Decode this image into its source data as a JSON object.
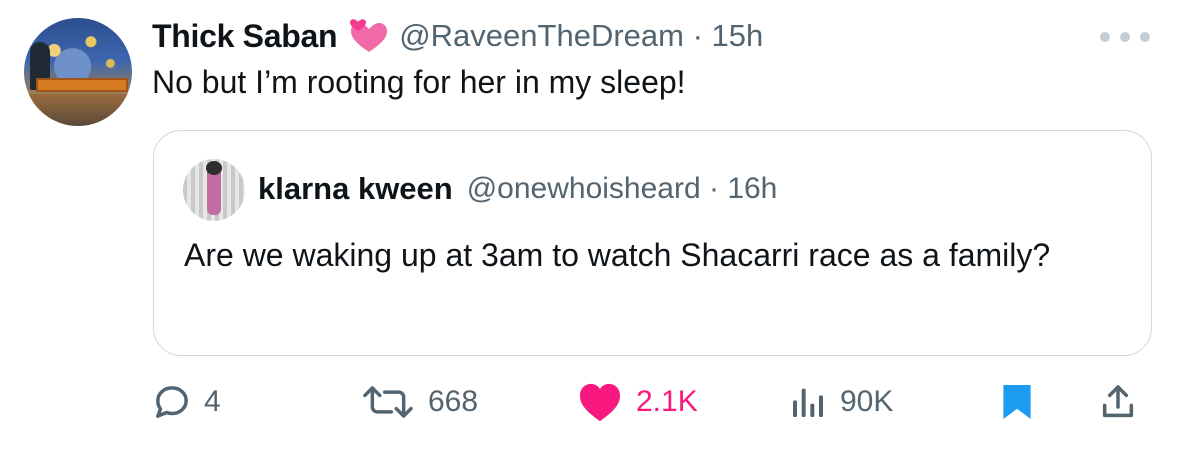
{
  "tweet": {
    "author_name": "Thick Saban",
    "author_emoji": "two-hearts-emoji",
    "handle_time": "@RaveenTheDream · 15h",
    "text": "No but I’m rooting for her in my sleep!"
  },
  "quoted_tweet": {
    "author_name": "klarna kween",
    "handle_time": "@onewhoisheard · 16h",
    "text": "Are we waking up at 3am to watch Shacarri race as a family?"
  },
  "actions": {
    "replies": "4",
    "retweets": "668",
    "likes": "2.1K",
    "views": "90K",
    "liked": true,
    "bookmarked": true
  },
  "colors": {
    "text_primary": "#0f1419",
    "text_secondary": "#536471",
    "like_pink": "#f91880",
    "bookmark_blue": "#1d9bf0",
    "border": "#cfd9de"
  },
  "icons": [
    "reply-icon",
    "retweet-icon",
    "heart-icon",
    "views-icon",
    "bookmark-icon",
    "share-icon",
    "more-icon"
  ]
}
